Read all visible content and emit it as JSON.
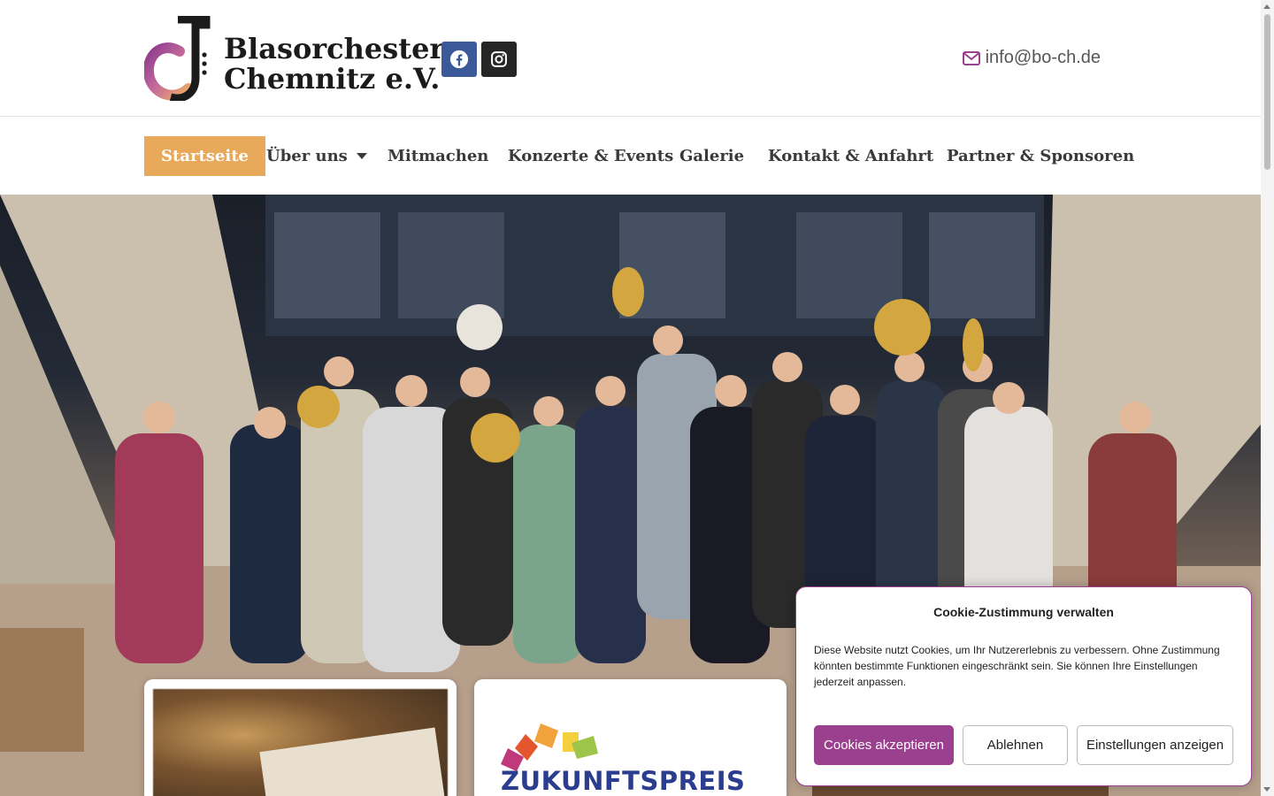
{
  "header": {
    "logo_line1": "Blasorchester",
    "logo_line2": "Chemnitz e.V.",
    "facebook_icon": "facebook-icon",
    "instagram_icon": "instagram-icon",
    "email": "info@bo-ch.de"
  },
  "nav": {
    "items": [
      {
        "label": "Startseite",
        "active": true
      },
      {
        "label": "Über uns",
        "has_dropdown": true
      },
      {
        "label": "Mitmachen"
      },
      {
        "label": "Konzerte & Events"
      },
      {
        "label": "Galerie"
      },
      {
        "label": "Kontakt & Anfahrt"
      },
      {
        "label": "Partner & Sponsoren"
      }
    ]
  },
  "hero": {
    "image_alt": "orchestra-group-photo"
  },
  "cards": {
    "card2_title": "ZUKUNFTSPREIS"
  },
  "cookie": {
    "title": "Cookie-Zustimmung verwalten",
    "text": "Diese Website nutzt Cookies, um Ihr Nutzererlebnis zu verbessern. Ohne Zustimmung könnten bestimmte Funktionen eingeschränkt sein. Sie können Ihre Einstellungen jederzeit anpassen.",
    "accept": "Cookies akzeptieren",
    "deny": "Ablehnen",
    "settings": "Einstellungen anzeigen"
  },
  "colors": {
    "accent_nav": "#e9a95b",
    "cookie_primary": "#9b3f8f",
    "facebook": "#3b5998",
    "instagram": "#262626",
    "mail_icon": "#9b3f8f"
  }
}
